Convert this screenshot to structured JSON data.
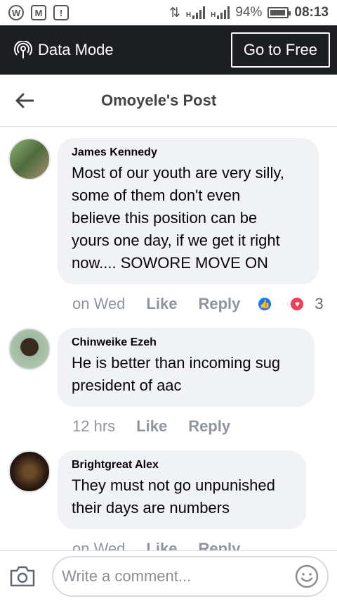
{
  "statusbar": {
    "network_type": "H",
    "battery_percent": "94%",
    "battery_level": 0.94,
    "time": "08:13"
  },
  "banner": {
    "data_mode_label": "Data Mode",
    "go_free_label": "Go to Free"
  },
  "header": {
    "title": "Omoyele's Post"
  },
  "comments": [
    {
      "author": "James Kennedy",
      "lines": [
        "Most of our youth are very silly,",
        "some of them don't even",
        "believe this position can be",
        "yours one day, if we get it right",
        "now.... SOWORE MOVE ON"
      ],
      "time": "on Wed",
      "like_label": "Like",
      "reply_label": "Reply",
      "reaction_count": "3"
    },
    {
      "author": "Chinweike Ezeh",
      "lines": [
        "He is better than incoming sug",
        "president of aac"
      ],
      "time": "12 hrs",
      "like_label": "Like",
      "reply_label": "Reply"
    },
    {
      "author": "Brightgreat Alex",
      "lines": [
        "They must not go unpunished",
        "their days are numbers"
      ],
      "time": "on Wed",
      "like_label": "Like",
      "reply_label": "Reply"
    }
  ],
  "composer": {
    "placeholder": "Write a comment..."
  },
  "colors": {
    "banner_bg": "#1c1e21",
    "bubble_bg": "#f0f2f5",
    "like_blue": "#1877f2",
    "love_red": "#f33e58"
  }
}
